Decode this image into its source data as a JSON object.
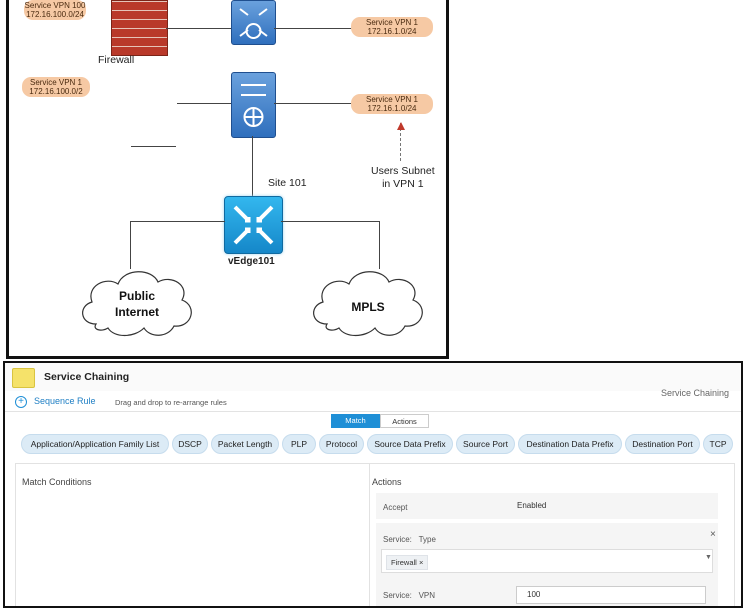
{
  "diagram": {
    "top_left_pill": {
      "line1": "Service VPN 100",
      "line2": "172.16.100.0/24"
    },
    "top_right_pill": {
      "line1": "Service VPN 1",
      "line2": "172.16.1.0/24"
    },
    "left_pill": {
      "line1": "Service VPN 1",
      "line2": "172.16.100.0/2"
    },
    "mid_right_pill": {
      "line1": "Service VPN 1",
      "line2": "172.16.1.0/24"
    },
    "firewall_label": "Firewall",
    "site_label": "Site 101",
    "users_label": "Users Subnet\nin VPN 1",
    "router_label": "vEdge101",
    "cloud_internet": "Public\nInternet",
    "cloud_mpls": "MPLS"
  },
  "ui": {
    "title": "Service Chaining",
    "breadcrumb_right": "Service Chaining",
    "sequence_rule_label": "Sequence Rule",
    "hint": "Drag and drop to re-arrange rules",
    "tabs": {
      "match": "Match",
      "actions": "Actions"
    },
    "chips": [
      "Application/Application Family List",
      "DSCP",
      "Packet Length",
      "PLP",
      "Protocol",
      "Source Data Prefix",
      "Source Port",
      "Destination Data Prefix",
      "Destination Port",
      "TCP"
    ],
    "match_conditions_label": "Match Conditions",
    "actions_label": "Actions",
    "accept": {
      "label": "Accept",
      "value": "Enabled"
    },
    "service": {
      "label": "Service:",
      "type_label": "Type",
      "selected": "Firewall"
    },
    "service_vpn": {
      "label": "Service:",
      "vpn_label": "VPN",
      "value": "100"
    }
  }
}
